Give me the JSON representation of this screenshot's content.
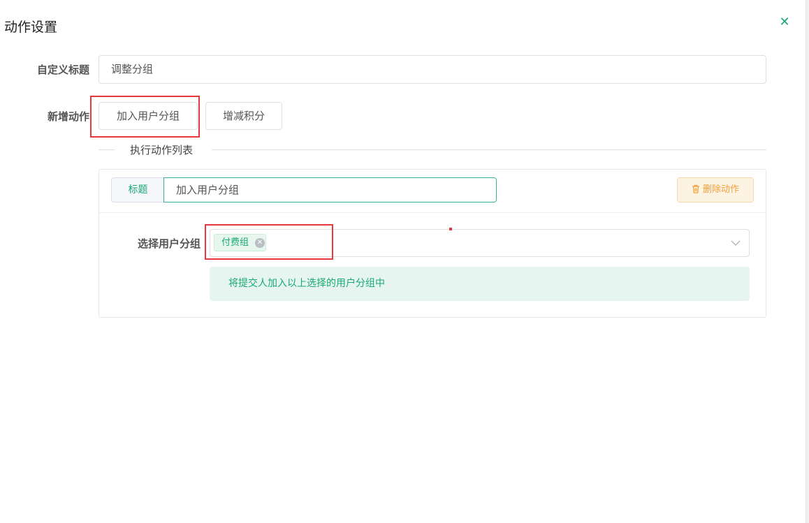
{
  "dialog": {
    "title": "动作设置",
    "close_icon": "close-icon"
  },
  "form": {
    "custom_title_label": "自定义标题",
    "custom_title_value": "调整分组",
    "add_action_label": "新增动作",
    "add_action_buttons": [
      "加入用户分组",
      "增减积分"
    ]
  },
  "action_list": {
    "divider_text": "执行动作列表",
    "items": [
      {
        "prepend_label": "标题",
        "title_value": "加入用户分组",
        "delete_label": "删除动作",
        "delete_icon": "trash-icon",
        "select_label": "选择用户分组",
        "selected_tags": [
          "付费组"
        ],
        "tip": "将提交人加入以上选择的用户分组中"
      }
    ]
  },
  "colors": {
    "accent": "#19a974",
    "warning": "#f0a03a",
    "highlight_box": "#e8383d"
  }
}
